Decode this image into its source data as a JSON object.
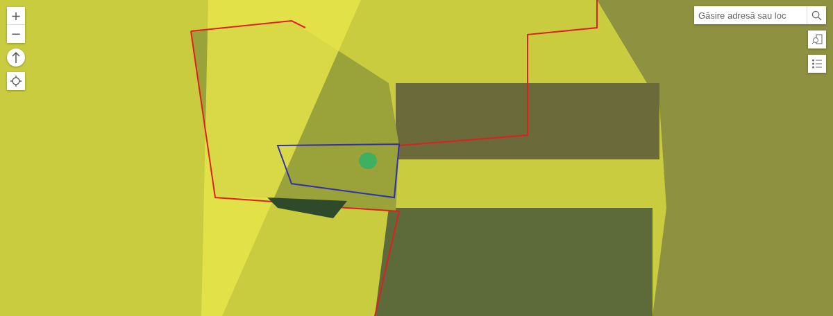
{
  "map_controls": {
    "zoom_in": "+",
    "zoom_out": "−"
  },
  "search": {
    "placeholder": "Găsire adresă sau loc"
  }
}
